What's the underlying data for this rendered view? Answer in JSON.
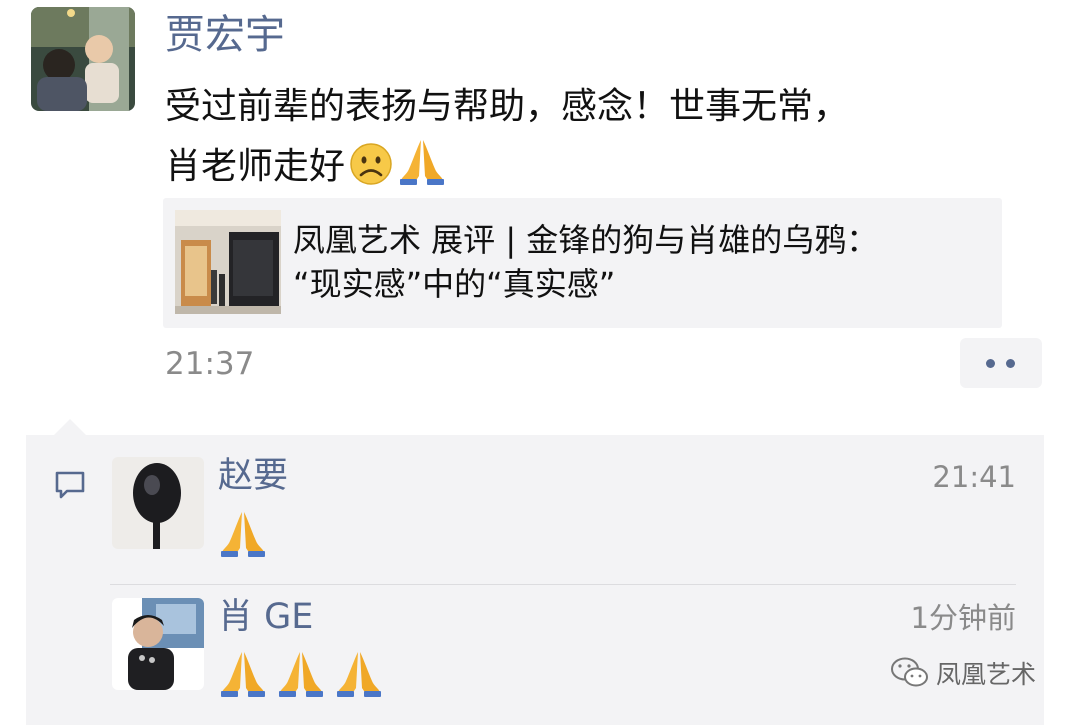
{
  "post": {
    "author": "贾宏宇",
    "text_lines": [
      "受过前辈的表扬与帮助，感念！世事无常，",
      "肖老师走好"
    ],
    "emojis": [
      "frowning-face-icon",
      "folded-hands-icon"
    ],
    "link_card": {
      "title_lines": [
        "凤凰艺术 展评 | 金锋的狗与肖雄的乌鸦：",
        "“现实感”中的“真实感”"
      ]
    },
    "time": "21:37"
  },
  "comments": [
    {
      "name": "赵要",
      "time": "21:41",
      "emojis": [
        "folded-hands-icon"
      ]
    },
    {
      "name": "肖 GE",
      "time": "1分钟前",
      "emojis": [
        "folded-hands-icon",
        "folded-hands-icon",
        "folded-hands-icon"
      ]
    }
  ],
  "watermark": {
    "text": "凤凰艺术"
  },
  "colors": {
    "link_name": "#56698f",
    "panel_bg": "#f3f3f5",
    "time_gray": "#8a8a8a"
  }
}
